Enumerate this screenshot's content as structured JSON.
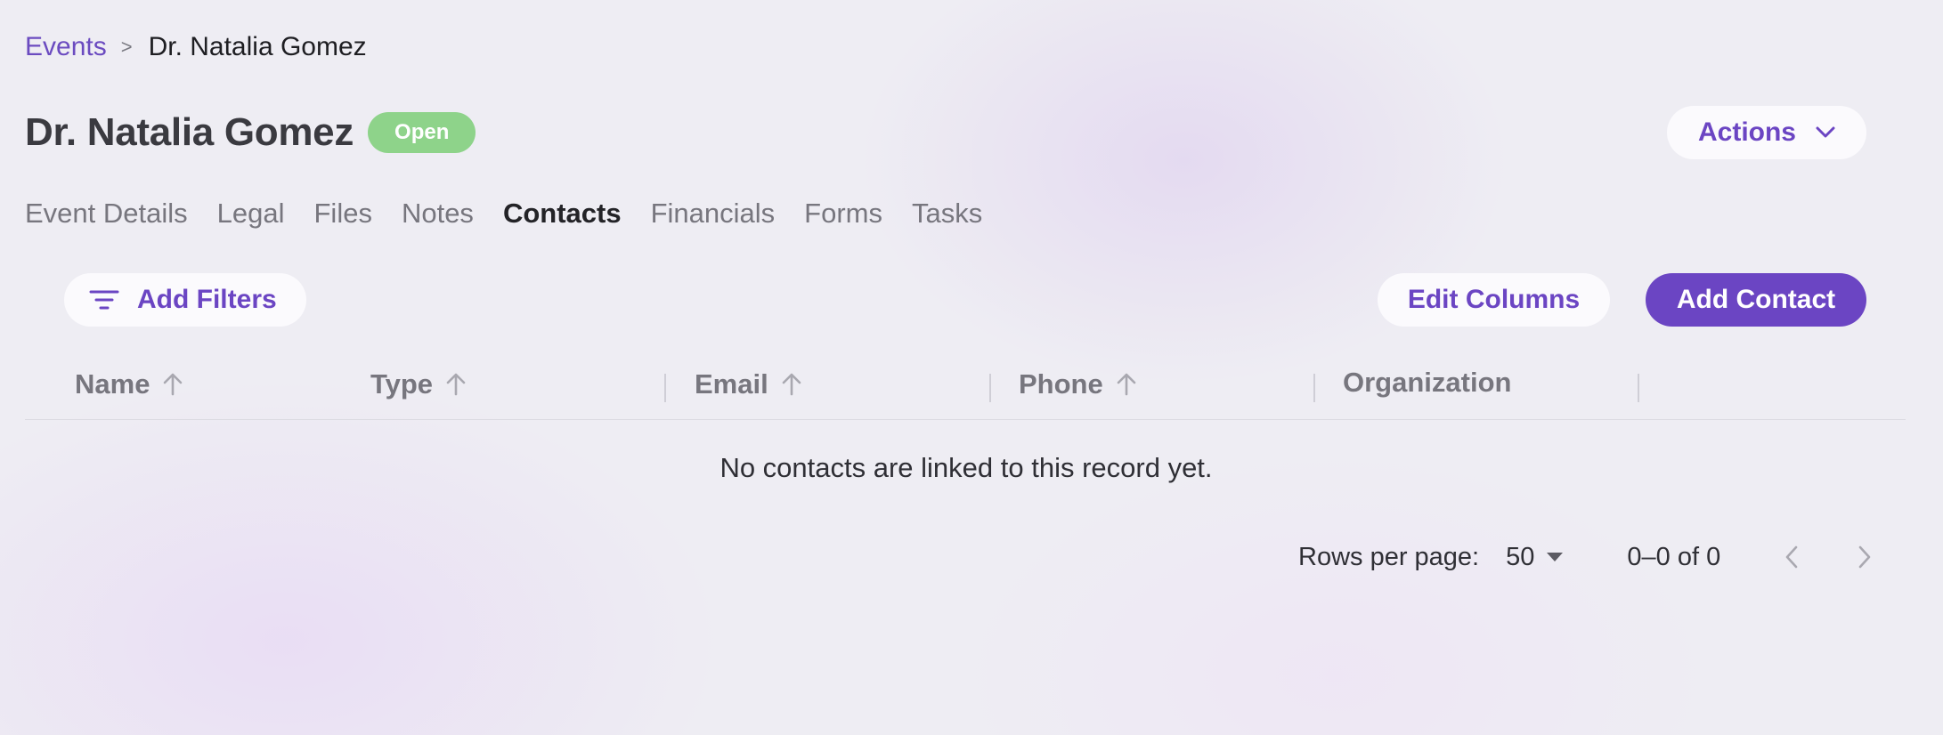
{
  "breadcrumb": {
    "parent": "Events",
    "separator": ">",
    "current": "Dr. Natalia Gomez"
  },
  "header": {
    "title": "Dr. Natalia Gomez",
    "status": "Open",
    "actions_label": "Actions"
  },
  "tabs": [
    {
      "label": "Event Details",
      "active": false
    },
    {
      "label": "Legal",
      "active": false
    },
    {
      "label": "Files",
      "active": false
    },
    {
      "label": "Notes",
      "active": false
    },
    {
      "label": "Contacts",
      "active": true
    },
    {
      "label": "Financials",
      "active": false
    },
    {
      "label": "Forms",
      "active": false
    },
    {
      "label": "Tasks",
      "active": false
    }
  ],
  "toolbar": {
    "filters_label": "Add Filters",
    "edit_columns_label": "Edit Columns",
    "add_contact_label": "Add Contact"
  },
  "table": {
    "columns": [
      "Name",
      "Type",
      "Email",
      "Phone",
      "Organization"
    ],
    "empty_message": "No contacts are linked to this record yet."
  },
  "pagination": {
    "rows_per_page_label": "Rows per page:",
    "rows_per_page": "50",
    "range": "0–0 of 0"
  },
  "colors": {
    "accent": "#6b45c3",
    "status_open": "#8ed38a",
    "breadcrumb_link": "#6b4bc0"
  },
  "icons": {
    "filter": "filter-icon",
    "actions": "chevron-down-icon",
    "sort": "arrow-up-icon",
    "rows_select": "caret-down-icon",
    "prev": "chevron-left-icon",
    "next": "chevron-right-icon"
  }
}
